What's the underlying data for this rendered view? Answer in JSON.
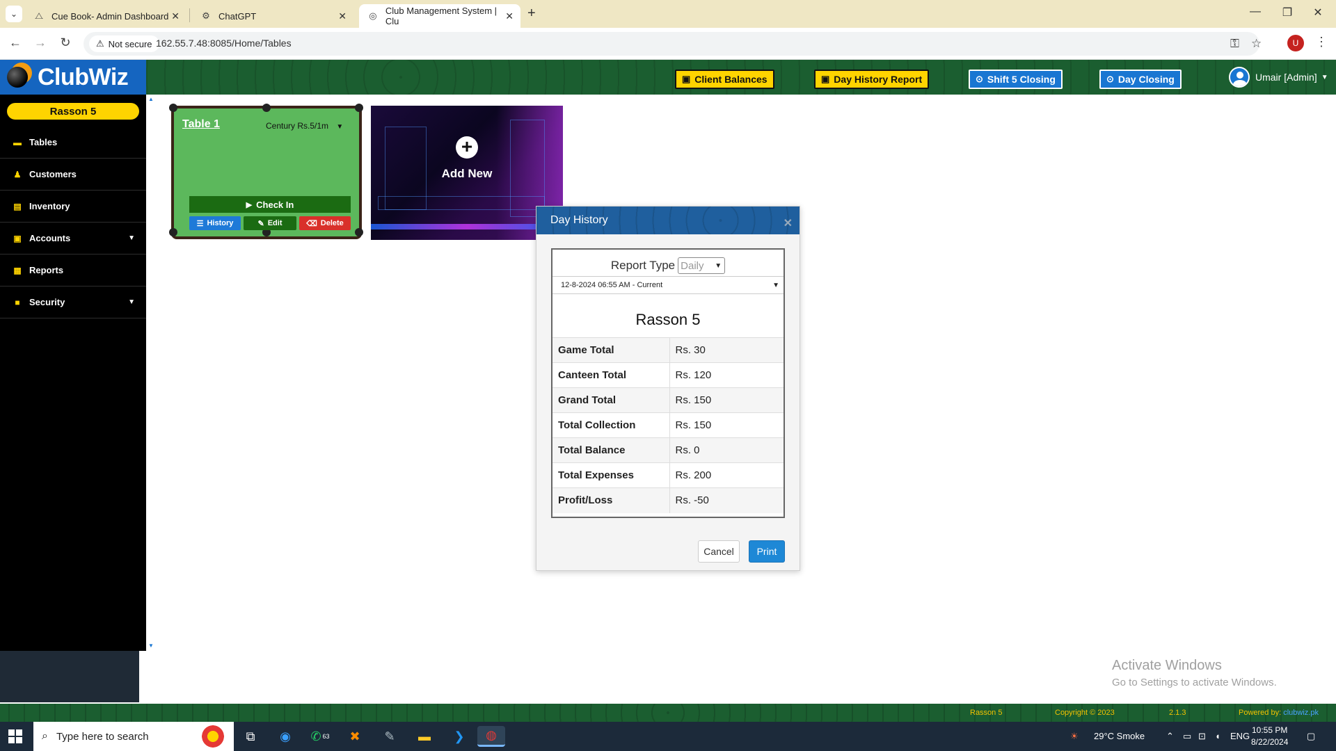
{
  "browser": {
    "tabs": [
      {
        "title": "Cue Book- Admin Dashboard",
        "icon": "cuebook-icon"
      },
      {
        "title": "ChatGPT",
        "icon": "chatgpt-icon"
      },
      {
        "title": "Club Management System | Clu",
        "icon": "site-icon"
      }
    ],
    "security_label": "Not secure",
    "url": "162.55.7.48:8085/Home/Tables",
    "profile_initial": "U"
  },
  "app": {
    "brand": "ClubWiz",
    "header_buttons": {
      "client_balances": "Client Balances",
      "day_history_report": "Day History Report",
      "shift_closing": "Shift 5 Closing",
      "day_closing": "Day Closing"
    },
    "user_label": "Umair [Admin]",
    "colors": {
      "header_green": "#1b5e30",
      "brand_blue": "#1565c0",
      "accent_yellow": "#ffd400",
      "table_green": "#5cb85c"
    }
  },
  "sidebar": {
    "club_name": "Rasson 5",
    "items": [
      {
        "label": "Tables",
        "icon": "tables-icon"
      },
      {
        "label": "Customers",
        "icon": "customers-icon"
      },
      {
        "label": "Inventory",
        "icon": "inventory-icon"
      },
      {
        "label": "Accounts",
        "icon": "accounts-icon"
      },
      {
        "label": "Reports",
        "icon": "reports-icon"
      },
      {
        "label": "Security",
        "icon": "lock-icon"
      }
    ]
  },
  "tables": {
    "table1": {
      "name": "Table 1",
      "rate": "Century Rs.5/1m",
      "check_in": "Check In",
      "history": "History",
      "edit": "Edit",
      "delete": "Delete"
    },
    "add_new": "Add New"
  },
  "modal": {
    "title": "Day History",
    "report_type_label": "Report Type",
    "report_type_value": "Daily",
    "period": "12-8-2024 06:55 AM - Current",
    "club_name": "Rasson 5",
    "rows": [
      {
        "label": "Game Total",
        "value": "Rs. 30"
      },
      {
        "label": "Canteen Total",
        "value": "Rs. 120"
      },
      {
        "label": "Grand Total",
        "value": "Rs. 150"
      },
      {
        "label": "Total Collection",
        "value": "Rs. 150"
      },
      {
        "label": "Total Balance",
        "value": "Rs. 0"
      },
      {
        "label": "Total Expenses",
        "value": "Rs. 200"
      },
      {
        "label": "Profit/Loss",
        "value": "Rs. -50"
      }
    ],
    "cancel": "Cancel",
    "print": "Print"
  },
  "watermark": {
    "line1": "Activate Windows",
    "line2": "Go to Settings to activate Windows."
  },
  "footer": {
    "club": "Rasson 5",
    "copyright": "Copyright © 2023",
    "version": "2.1.3",
    "powered_by": "Powered by:",
    "powered_link": "clubwiz.pk"
  },
  "taskbar": {
    "search_placeholder": "Type here to search",
    "whatsapp_badge": "63",
    "weather": "29°C  Smoke",
    "language": "ENG",
    "time": "10:55 PM",
    "date": "8/22/2024"
  }
}
